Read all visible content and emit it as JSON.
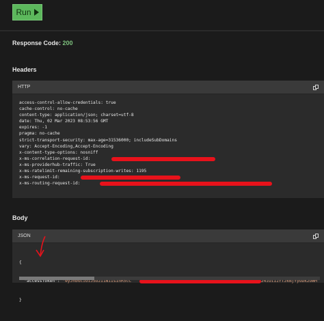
{
  "run_button": {
    "label": "Run"
  },
  "response": {
    "label": "Response Code:",
    "code": "200"
  },
  "headers_section": {
    "title": "Headers",
    "panel_label": "HTTP",
    "lines": [
      "access-control-allow-credentials: true",
      "cache-control: no-cache",
      "content-type: application/json; charset=utf-8",
      "date: Thu, 02 Mar 2023 08:53:56 GMT",
      "expires: -1",
      "pragma: no-cache",
      "strict-transport-security: max-age=31536000; includeSubDomains",
      "vary: Accept-Encoding,Accept-Encoding",
      "x-content-type-options: nosniff",
      "x-ms-correlation-request-id:",
      "x-ms-providerhub-traffic: True",
      "x-ms-ratelimit-remaining-subscription-writes: 1195",
      "x-ms-request-id:",
      "x-ms-routing-request-id:"
    ]
  },
  "body_section": {
    "title": "Body",
    "panel_label": "JSON",
    "open_brace": "{",
    "token_key": "\"accessToken\": ",
    "token_value_start": "\"eyJhbGciOiJSUzI1NiIsInR5cC",
    "token_value_end": "cNpb24iOiIzYTJkNjYyODk2OWM",
    "close_brace": "}"
  },
  "colors": {
    "accent": "#5cb85c",
    "code_ok": "#7ec27e",
    "redaction": "#e8121b",
    "json_string": "#d79a7a"
  }
}
